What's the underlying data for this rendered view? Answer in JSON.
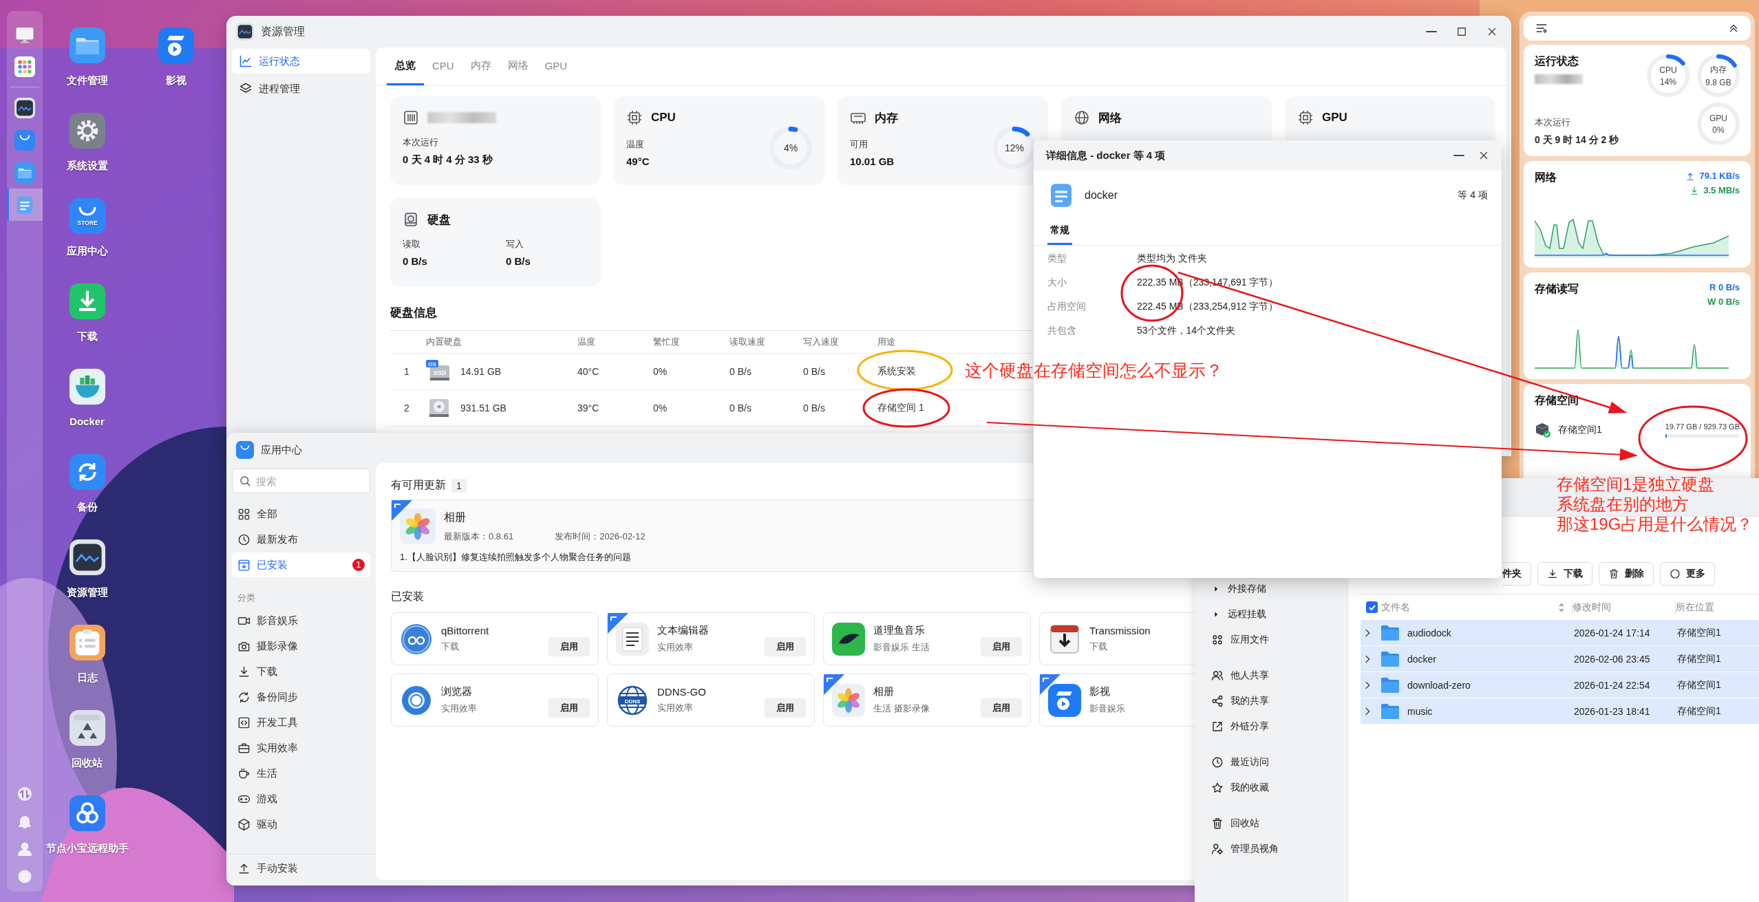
{
  "dock": {
    "pinned": [
      {
        "kind": "monitor",
        "selected": false
      },
      {
        "kind": "launcher",
        "selected": false
      }
    ],
    "running": [
      {
        "kind": "resource",
        "selected": false
      },
      {
        "kind": "store",
        "selected": false
      },
      {
        "kind": "files",
        "selected": false
      },
      {
        "kind": "notes",
        "selected": true
      }
    ],
    "system": [
      {
        "kind": "transfer"
      },
      {
        "kind": "bell"
      },
      {
        "kind": "user"
      },
      {
        "kind": "settings"
      }
    ]
  },
  "desktop_icons": [
    {
      "label": "文件管理",
      "kind": "files"
    },
    {
      "label": "系统设置",
      "kind": "settings"
    },
    {
      "label": "应用中心",
      "kind": "store",
      "icon_text": "STORE"
    },
    {
      "label": "下载",
      "kind": "download"
    },
    {
      "label": "Docker",
      "kind": "docker"
    },
    {
      "label": "备份",
      "kind": "backup"
    },
    {
      "label": "资源管理",
      "kind": "resource"
    },
    {
      "label": "日志",
      "kind": "log"
    },
    {
      "label": "回收站",
      "kind": "recycle"
    },
    {
      "label": "节点小宝远程助手",
      "kind": "remote"
    },
    {
      "label": "影视",
      "kind": "video"
    }
  ],
  "resource_manager": {
    "title": "资源管理",
    "sidebar": [
      {
        "label": "运行状态",
        "kind": "chart",
        "selected": true
      },
      {
        "label": "进程管理",
        "kind": "layers",
        "selected": false
      }
    ],
    "tabs": [
      {
        "label": "总览",
        "selected": true
      },
      {
        "label": "CPU",
        "selected": false
      },
      {
        "label": "内存",
        "selected": false
      },
      {
        "label": "网络",
        "selected": false
      },
      {
        "label": "GPU",
        "selected": false
      }
    ],
    "cards": [
      {
        "kind": "system",
        "stats": [
          {
            "label": "本次运行",
            "value": "0 天 4 时 4 分 33 秒"
          }
        ]
      },
      {
        "kind": "cpu",
        "title": "CPU",
        "stats": [
          {
            "label": "温度",
            "value": "49°C"
          }
        ],
        "gauge": {
          "reading": "4%",
          "level": 0.04
        }
      },
      {
        "kind": "memory",
        "title": "内存",
        "stats": [
          {
            "label": "可用",
            "value": "10.01 GB"
          }
        ],
        "gauge": {
          "reading": "12%",
          "level": 0.12
        }
      },
      {
        "kind": "network",
        "title": "网络"
      },
      {
        "kind": "gpu",
        "title": "GPU"
      },
      {
        "kind": "disk",
        "title": "硬盘",
        "stats": [
          {
            "label": "读取",
            "value": "0 B/s"
          },
          {
            "label": "写入",
            "value": "0 B/s"
          }
        ]
      }
    ],
    "disk_table": {
      "title": "硬盘信息",
      "columns": [
        "内置硬盘",
        "温度",
        "繁忙度",
        "读取速度",
        "写入速度",
        "用途"
      ],
      "rows": [
        {
          "index": "1",
          "kind": "ssd",
          "icon_text": "SSD",
          "badge": "OS",
          "cells": [
            "14.91 GB",
            "40°C",
            "0%",
            "0 B/s",
            "0 B/s",
            "系统安装"
          ]
        },
        {
          "index": "2",
          "kind": "hdd",
          "cells": [
            "931.51 GB",
            "39°C",
            "0%",
            "0 B/s",
            "0 B/s",
            "存储空间 1"
          ]
        }
      ]
    }
  },
  "app_center": {
    "title": "应用中心",
    "search": {
      "placeholder": "搜索"
    },
    "nav": [
      {
        "label": "全部",
        "kind": "grid",
        "selected": false
      },
      {
        "label": "最新发布",
        "kind": "clock",
        "selected": false
      },
      {
        "label": "已安装",
        "kind": "installed",
        "selected": true,
        "badge": "1"
      }
    ],
    "category_heading": "分类",
    "categories": [
      {
        "label": "影音娱乐",
        "kind": "video"
      },
      {
        "label": "摄影录像",
        "kind": "camera"
      },
      {
        "label": "下载",
        "kind": "download"
      },
      {
        "label": "备份同步",
        "kind": "sync"
      },
      {
        "label": "开发工具",
        "kind": "code"
      },
      {
        "label": "实用效率",
        "kind": "briefcase"
      },
      {
        "label": "生活",
        "kind": "cup"
      },
      {
        "label": "游戏",
        "kind": "gamepad"
      },
      {
        "label": "驱动",
        "kind": "cube"
      }
    ],
    "footer": {
      "label": "手动安装"
    },
    "updates": {
      "title": "有可用更新",
      "count": "1",
      "items": [
        {
          "name": "相册",
          "kind": "photos",
          "tagged": true,
          "version": "最新版本：0.8.61",
          "date": "发布时间：2026-02-12",
          "note": "1.【人脸识别】修复连续拍照触发多个人物聚合任务的问题"
        }
      ]
    },
    "installed": {
      "title": "已安装",
      "apps": [
        {
          "name": "qBittorrent",
          "kind": "qb",
          "tagged": false,
          "category": "下载",
          "action": "启用"
        },
        {
          "name": "文本编辑器",
          "kind": "editor",
          "tagged": true,
          "category": "实用效率",
          "action": "启用"
        },
        {
          "name": "道理鱼音乐",
          "kind": "music",
          "tagged": false,
          "category": "影音娱乐 生活",
          "action": "启用"
        },
        {
          "name": "Transmission",
          "kind": "transmission",
          "tagged": false,
          "category": "下载"
        },
        {
          "name": "浏览器",
          "kind": "browser",
          "tagged": false,
          "category": "实用效率",
          "action": "启用"
        },
        {
          "name": "DDNS-GO",
          "kind": "ddns",
          "tagged": false,
          "icon_text": "DDNS",
          "category": "实用效率",
          "action": "启用"
        },
        {
          "name": "相册",
          "kind": "photos",
          "tagged": true,
          "category": "生活 摄影录像",
          "action": "启用"
        },
        {
          "name": "影视",
          "kind": "video",
          "tagged": true,
          "category": "影音娱乐"
        }
      ]
    }
  },
  "widgets": {
    "status": {
      "title": "运行状态",
      "uptime_label": "本次运行",
      "uptime": "0 天 9 时 14 分 2 秒",
      "gauges": [
        {
          "label": "CPU",
          "reading": "14%",
          "level": 0.14
        },
        {
          "label": "内存",
          "reading": "9.8 GB",
          "level": 0.16
        },
        {
          "label": "GPU",
          "reading": "0%",
          "level": 0
        }
      ]
    },
    "network": {
      "title": "网络",
      "upload": "79.1 KB/s",
      "download": "3.5 MB/s"
    },
    "storage_io": {
      "title": "存储读写",
      "read": "R 0 B/s",
      "write": "W 0 B/s"
    },
    "storage": {
      "title": "存储空间",
      "pools": [
        {
          "name": "存储空间1",
          "usage": "19.77 GB / 929.73 GB",
          "level": 0.02
        }
      ]
    }
  },
  "file_manager": {
    "sidebar": [
      {
        "items": [
          {
            "label": "外接存储",
            "kind": "caret"
          },
          {
            "label": "远程挂载",
            "kind": "caret"
          },
          {
            "label": "应用文件",
            "kind": "apps"
          }
        ]
      },
      {
        "items": [
          {
            "label": "他人共享",
            "kind": "people"
          },
          {
            "label": "我的共享",
            "kind": "share"
          },
          {
            "label": "外链分享",
            "kind": "link"
          }
        ]
      },
      {
        "items": [
          {
            "label": "最近访问",
            "kind": "clock"
          },
          {
            "label": "我的收藏",
            "kind": "star"
          }
        ]
      },
      {
        "items": [
          {
            "label": "回收站",
            "kind": "trash"
          },
          {
            "label": "管理员视角",
            "kind": "admin"
          }
        ]
      }
    ],
    "toolbar": [
      {
        "label": "件夹",
        "kind": "plain"
      },
      {
        "label": "下载",
        "kind": "download"
      },
      {
        "label": "删除",
        "kind": "trash"
      },
      {
        "label": "更多",
        "kind": "more"
      }
    ],
    "select_all": true,
    "columns": [
      {
        "label": "文件名",
        "sortable": true
      },
      {
        "label": "修改时间",
        "sortable": false
      },
      {
        "label": "所在位置",
        "sortable": false
      }
    ],
    "rows": [
      {
        "name": "audiodock",
        "modified": "2026-01-24 17:14",
        "location": "存储空间1",
        "selected": true
      },
      {
        "name": "docker",
        "modified": "2026-02-06 23:45",
        "location": "存储空间1",
        "selected": true
      },
      {
        "name": "download-zero",
        "modified": "2026-01-24 22:54",
        "location": "存储空间1",
        "selected": true
      },
      {
        "name": "music",
        "modified": "2026-01-23 18:41",
        "location": "存储空间1",
        "selected": true
      }
    ]
  },
  "detail_dialog": {
    "title": "详细信息 - docker 等 4 项",
    "name": "docker",
    "summary": "等 4 项",
    "tabs": [
      {
        "label": "常规",
        "selected": true
      }
    ],
    "properties": [
      {
        "label": "类型",
        "value": "类型均为 文件夹"
      },
      {
        "label": "大小",
        "value": "222.35 MB（233,147,691 字节）"
      },
      {
        "label": "占用空间",
        "value": "222.45 MB（233,254,912 字节）"
      },
      {
        "label": "共包含",
        "value": "53个文件，14个文件夹"
      }
    ]
  },
  "annotations": {
    "notes": [
      {
        "lines": [
          "这个硬盘在存储空间怎么不显示？"
        ]
      },
      {
        "lines": [
          "存储空间1是独立硬盘",
          "系统盘在别的地方",
          "那这19G占用是什么情况？"
        ]
      }
    ]
  }
}
